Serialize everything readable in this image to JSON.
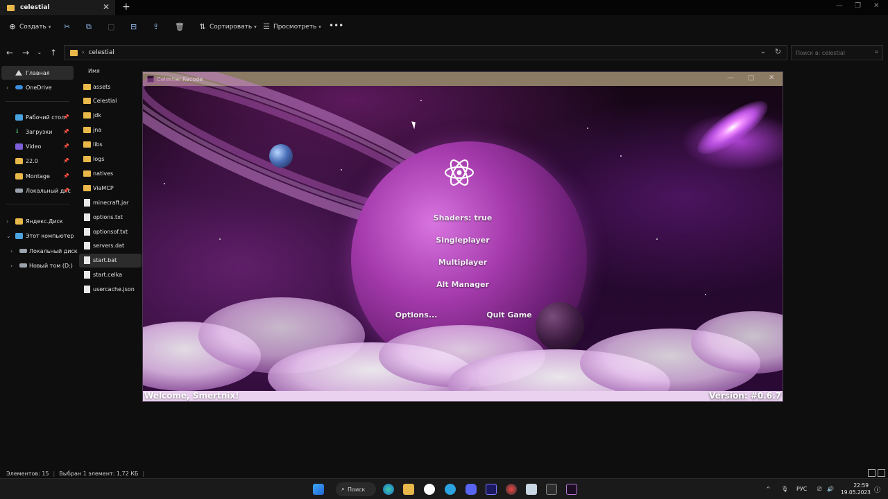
{
  "explorer": {
    "tab_title": "celestial",
    "toolbar": {
      "create_label": "Создать",
      "sort_label": "Сортировать",
      "view_label": "Просмотреть"
    },
    "address": {
      "path_segment": "celestial"
    },
    "search_placeholder": "Поиск в: celestial",
    "sidebar": {
      "home": "Главная",
      "onedrive": "OneDrive",
      "desktop": "Рабочий стол",
      "downloads": "Загрузки",
      "video": "Video",
      "folder_22": "22.0",
      "montage": "Montage",
      "local_disk_pinned": "Локальный дис",
      "yandex_disk": "Яндекс.Диск",
      "this_pc": "Этот компьютер",
      "local_disk": "Локальный диск",
      "new_volume": "Новый том (D:)"
    },
    "list_header_name": "Имя",
    "files": [
      {
        "name": "assets",
        "kind": "folder"
      },
      {
        "name": "Celestial",
        "kind": "folder"
      },
      {
        "name": "jdk",
        "kind": "folder"
      },
      {
        "name": "jna",
        "kind": "folder"
      },
      {
        "name": "libs",
        "kind": "folder"
      },
      {
        "name": "logs",
        "kind": "folder"
      },
      {
        "name": "natives",
        "kind": "folder"
      },
      {
        "name": "ViaMCP",
        "kind": "folder"
      },
      {
        "name": "minecraft.jar",
        "kind": "file"
      },
      {
        "name": "options.txt",
        "kind": "file"
      },
      {
        "name": "optionsof.txt",
        "kind": "file"
      },
      {
        "name": "servers.dat",
        "kind": "file"
      },
      {
        "name": "start.bat",
        "kind": "file",
        "selected": true
      },
      {
        "name": "start.celka",
        "kind": "file"
      },
      {
        "name": "usercache.json",
        "kind": "file"
      }
    ],
    "status": {
      "items": "Элементов: 15",
      "selected": "Выбран 1 элемент: 1,72 КБ"
    }
  },
  "game": {
    "window_title": "Celestial Recode",
    "menu": {
      "shaders": "Shaders: true",
      "singleplayer": "Singleplayer",
      "multiplayer": "Multiplayer",
      "alt_manager": "Alt Manager",
      "options": "Options...",
      "quit": "Quit Game"
    },
    "welcome": "Welcome, Smertnix!",
    "version": "Version: #0.6.7"
  },
  "taskbar": {
    "search_label": "Поиск",
    "language": "РУС",
    "time": "22:59",
    "date": "19.05.2023"
  },
  "colors": {
    "accent_folder": "#e8b84a",
    "game_titlebar": "#8b7b64",
    "planet": "#a43aab"
  }
}
